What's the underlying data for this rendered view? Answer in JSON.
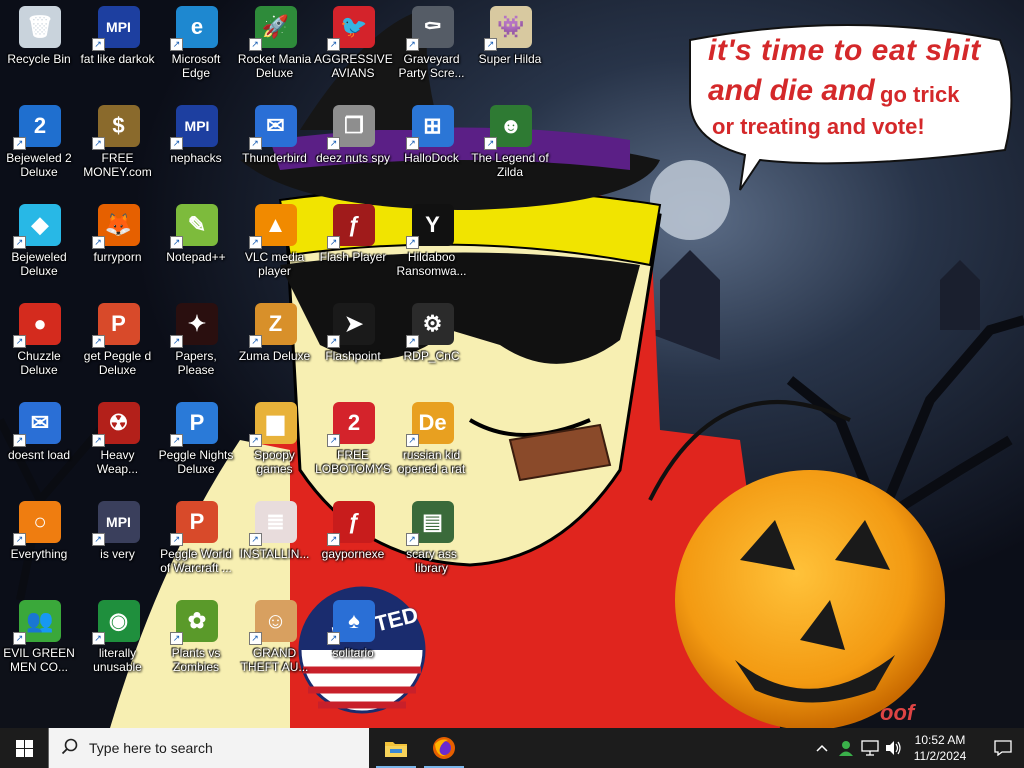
{
  "wallpaper": {
    "speech_line1": "it's time to eat shit",
    "speech_line2a": "and die and",
    "speech_line2b": "go trick",
    "speech_line3": "or treating and vote!",
    "stamp_text": "I VOTED",
    "corner_text": "oof"
  },
  "desktop": {
    "icons": [
      {
        "label": "Recycle Bin",
        "icon": "recycle-bin-icon",
        "color": "#c9d3dc",
        "glyph": "🗑"
      },
      {
        "label": "fat like darkok",
        "icon": "mpi-logo-icon",
        "color": "#1d3fa0",
        "glyph": "MPI"
      },
      {
        "label": "Microsoft Edge",
        "icon": "edge-icon",
        "color": "#1e88d0",
        "glyph": "e"
      },
      {
        "label": "Rocket Mania Deluxe",
        "icon": "rocket-icon",
        "color": "#2e8b3a",
        "glyph": "🚀"
      },
      {
        "label": "AGGRESSIVE AVIANS",
        "icon": "angry-bird-icon",
        "color": "#d4232b",
        "glyph": "🐦"
      },
      {
        "label": "Graveyard Party Scre...",
        "icon": "graveyard-icon",
        "color": "#555c66",
        "glyph": "⚰"
      },
      {
        "label": "Super Hilda",
        "icon": "pixel-character-icon",
        "color": "#d8c9a0",
        "glyph": "👾"
      },
      {
        "label": "Bejeweled 2 Deluxe",
        "icon": "bejeweled-2-icon",
        "color": "#1f6fcf",
        "glyph": "2"
      },
      {
        "label": "FREE MONEY.com",
        "icon": "money-bag-icon",
        "color": "#8a6a2c",
        "glyph": "$"
      },
      {
        "label": "nephacks",
        "icon": "mpi-logo-icon",
        "color": "#1d3fa0",
        "glyph": "MPI"
      },
      {
        "label": "Thunderbird",
        "icon": "thunderbird-icon",
        "color": "#2a6fd6",
        "glyph": "✉"
      },
      {
        "label": "deez nuts spy",
        "icon": "windows-stack-icon",
        "color": "#8e8e8e",
        "glyph": "❐"
      },
      {
        "label": "HalloDock",
        "icon": "windows-logo-icon",
        "color": "#2b76d6",
        "glyph": "⊞"
      },
      {
        "label": "The Legend of Zilda",
        "icon": "zelda-icon",
        "color": "#2e7a33",
        "glyph": "☻"
      },
      {
        "label": "Bejeweled Deluxe",
        "icon": "diamond-icon",
        "color": "#28b8e6",
        "glyph": "◆"
      },
      {
        "label": "furryporn",
        "icon": "firefox-icon",
        "color": "#e66000",
        "glyph": "🦊"
      },
      {
        "label": "Notepad++",
        "icon": "notepad-icon",
        "color": "#7dbb3c",
        "glyph": "✎"
      },
      {
        "label": "VLC media player",
        "icon": "vlc-cone-icon",
        "color": "#f18a00",
        "glyph": "▲"
      },
      {
        "label": "Flash Player",
        "icon": "flash-icon",
        "color": "#a01b1b",
        "glyph": "ƒ"
      },
      {
        "label": "Hildaboo Ransomwa...",
        "icon": "yashma-icon",
        "color": "#111111",
        "glyph": "Y"
      },
      {
        "label": "Chuzzle Deluxe",
        "icon": "chuzzle-icon",
        "color": "#d42b1e",
        "glyph": "●"
      },
      {
        "label": "get Peggle d Deluxe",
        "icon": "peggle-icon",
        "color": "#d84a2a",
        "glyph": "P"
      },
      {
        "label": "Papers, Please",
        "icon": "papers-please-icon",
        "color": "#2a0f0f",
        "glyph": "✦"
      },
      {
        "label": "Zuma Deluxe",
        "icon": "zuma-icon",
        "color": "#d8902a",
        "glyph": "Z"
      },
      {
        "label": "Flashpoint",
        "icon": "flashpoint-icon",
        "color": "#1a1a1a",
        "glyph": "➤"
      },
      {
        "label": "RDP_CnC",
        "icon": "rdp-icon",
        "color": "#2b2b2b",
        "glyph": "⚙"
      },
      {
        "label": "doesnt load",
        "icon": "thunderbird-icon",
        "color": "#2a6fd6",
        "glyph": "✉"
      },
      {
        "label": "Heavy Weap...",
        "icon": "radiation-icon",
        "color": "#b3201a",
        "glyph": "☢"
      },
      {
        "label": "Peggle Nights Deluxe",
        "icon": "peggle-icon",
        "color": "#2a7ad8",
        "glyph": "P"
      },
      {
        "label": "Spoopy games",
        "icon": "folder-icon",
        "color": "#e8b23a",
        "glyph": "▆"
      },
      {
        "label": "FREE LOBOTOMYS",
        "icon": "bejeweled-2-icon",
        "color": "#d4232b",
        "glyph": "2"
      },
      {
        "label": "russian kid opened a rat",
        "icon": "de-logo-icon",
        "color": "#e8a020",
        "glyph": "De"
      },
      {
        "label": "Everything",
        "icon": "everything-search-icon",
        "color": "#ef7d10",
        "glyph": "○"
      },
      {
        "label": "is very",
        "icon": "mpi-logo-icon",
        "color": "#3a3f5c",
        "glyph": "MPI"
      },
      {
        "label": "Peggle World of Warcraft ...",
        "icon": "peggle-icon",
        "color": "#d84a2a",
        "glyph": "P"
      },
      {
        "label": "INSTALLIN...",
        "icon": "document-icon",
        "color": "#e8dcdc",
        "glyph": "≣"
      },
      {
        "label": "gaypornexe",
        "icon": "flash-icon",
        "color": "#c81c1c",
        "glyph": "ƒ"
      },
      {
        "label": "scary ass library",
        "icon": "library-icon",
        "color": "#3a6a3a",
        "glyph": "▤"
      },
      {
        "label": "EVIL GREEN MEN CO...",
        "icon": "messenger-icon",
        "color": "#3aa83a",
        "glyph": "👥"
      },
      {
        "label": "literally unusable",
        "icon": "chrome-icon",
        "color": "#1f8f3d",
        "glyph": "◉"
      },
      {
        "label": "Plants vs Zombies",
        "icon": "plants-vs-zombies-icon",
        "color": "#5a9a2a",
        "glyph": "✿"
      },
      {
        "label": "GRAND THEFT AU...",
        "icon": "gta-icon",
        "color": "#d8a060",
        "glyph": "☺"
      },
      {
        "label": "solitario",
        "icon": "cards-icon",
        "color": "#2a6fd6",
        "glyph": "♠"
      }
    ]
  },
  "taskbar": {
    "search_placeholder": "Type here to search",
    "time": "10:52 AM",
    "date": "11/2/2024",
    "pinned": [
      "File Explorer",
      "Firefox"
    ]
  }
}
